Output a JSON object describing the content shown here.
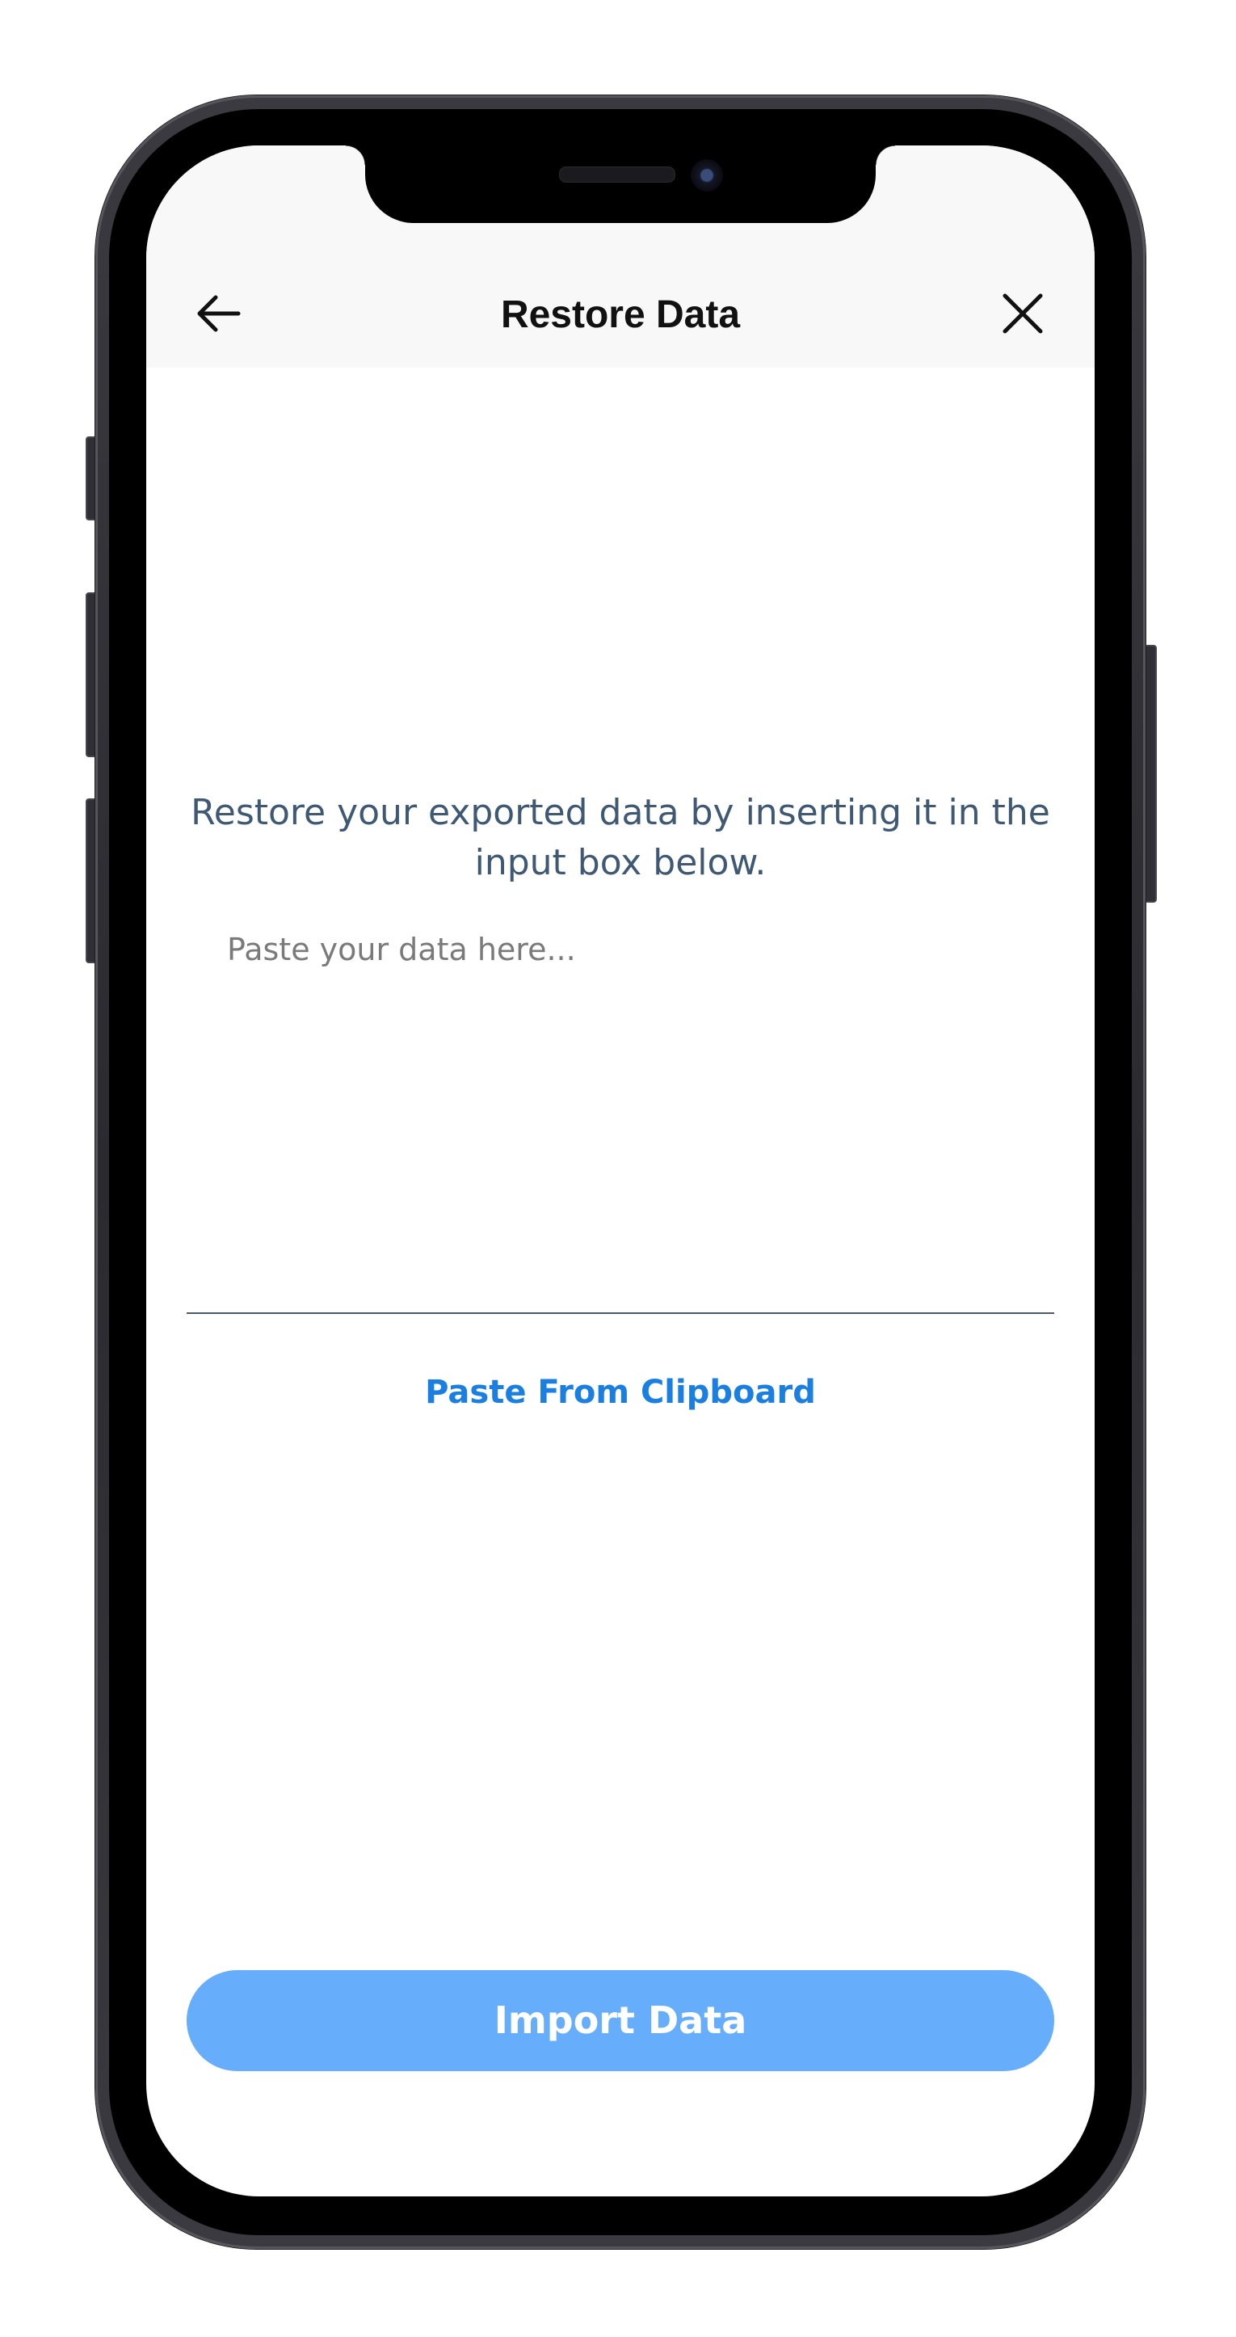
{
  "header": {
    "title": "Restore Data",
    "back_icon": "arrow-left-icon",
    "close_icon": "close-icon"
  },
  "main": {
    "instructions": "Restore your exported data by inserting it in the input box below.",
    "input_placeholder": "Paste your data here...",
    "input_value": "",
    "paste_label": "Paste From Clipboard"
  },
  "footer": {
    "import_label": "Import Data"
  },
  "colors": {
    "header_bg": "#f8f8f8",
    "accent_link": "#1a7fe0",
    "button_disabled_bg": "#66adfb",
    "instruction_text": "#3f5873"
  }
}
